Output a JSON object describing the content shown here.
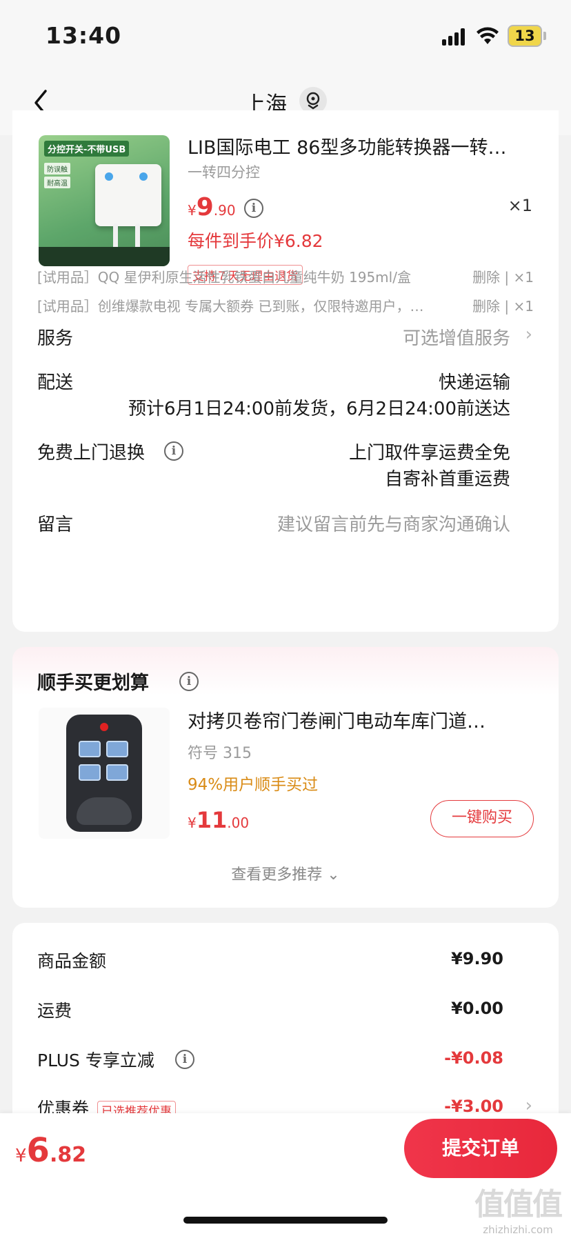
{
  "status_bar": {
    "time": "13:40",
    "battery": "13"
  },
  "nav": {
    "title": "上海"
  },
  "order_item": {
    "title": "LIB国际电工 86型多功能转换器一转…",
    "spec": "一转四分控",
    "price_currency": "¥",
    "price_int": "9",
    "price_dec": ".90",
    "info": "i",
    "quantity": "×1",
    "final_price": "每件到手价¥6.82",
    "return_badge": "支持７天无理由退货",
    "image_tag": "分控开关-不带USB",
    "image_side1": "防误触",
    "image_side2": "耐高温"
  },
  "trial_items": [
    {
      "text": "[试用品］QQ 星伊利原生活性乳铁蛋白儿童纯牛奶 195ml/盒",
      "action": "删除 | ×1"
    },
    {
      "text": "[试用品］创维爆款电视 专属大额券 已到账，仅限特邀用户，…",
      "action": "删除 | ×1"
    }
  ],
  "rows": {
    "service_label": "服务",
    "service_value": "可选增值服务",
    "delivery_label": "配送",
    "delivery_method": "快递运输",
    "delivery_time": "预计6月1日24:00前发货，6月2日24:00前送达",
    "return_label": "免费上门退换",
    "return_value_1": "上门取件享运费全免",
    "return_value_2": "自寄补首重运费",
    "message_label": "留言",
    "message_placeholder": "建议留言前先与商家沟通确认",
    "chevron": "›"
  },
  "recommend": {
    "title": "顺手买更划算",
    "name": "对拷贝卷帘门卷闸门电动车库门道…",
    "spec": "符号 315",
    "stat": "94%用户顺手买过",
    "price_currency": "¥",
    "price_int": "11",
    "price_dec": ".00",
    "buy_label": "一键购买",
    "more_label": "查看更多推荐 ⌄"
  },
  "summary": {
    "items": [
      {
        "label": "商品金额",
        "value": "¥9.90"
      },
      {
        "label": "运费",
        "value": "¥0.00"
      },
      {
        "label": "PLUS 专享立减",
        "value": "-¥0.08"
      },
      {
        "label": "优惠券",
        "value": "-¥3.00"
      }
    ],
    "coupon_tag": "已选推荐优惠"
  },
  "bottom_bar": {
    "total_currency": "¥",
    "total_int": "6",
    "total_dec": ".82",
    "submit_label": "提交订单",
    "watermark_big": "值值值",
    "watermark_small": "zhizhizhi.com"
  },
  "colors": {
    "accent": "#e4393c",
    "orange": "#d98b16",
    "background": "#f2f2f2"
  }
}
